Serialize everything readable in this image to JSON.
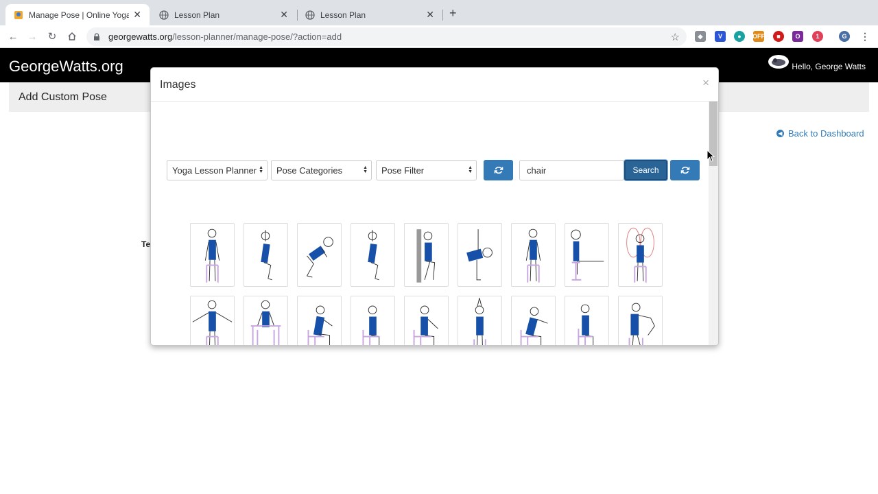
{
  "browser": {
    "tabs": [
      {
        "title": "Manage Pose | Online Yoga & F",
        "active": true
      },
      {
        "title": "Lesson Plan",
        "active": false
      },
      {
        "title": "Lesson Plan",
        "active": false
      }
    ],
    "url_host": "georgewatts.org",
    "url_path": "/lesson-planner/manage-pose/?action=add"
  },
  "site": {
    "brand": "GeorgeWatts.org",
    "greeting": "Hello, George Watts",
    "page_title": "Add Custom Pose",
    "back_link": "Back to Dashboard",
    "truncated_label": "Te"
  },
  "modal": {
    "title": "Images",
    "close": "×",
    "filters": {
      "planner": "Yoga Lesson Planner",
      "categories": "Pose Categories",
      "pose_filter": "Pose Filter"
    },
    "search_value": "chair",
    "search_button": "Search"
  },
  "colors": {
    "accent": "#337ab7",
    "pose_body": "#1750a8",
    "chair": "#c8a6e0"
  }
}
